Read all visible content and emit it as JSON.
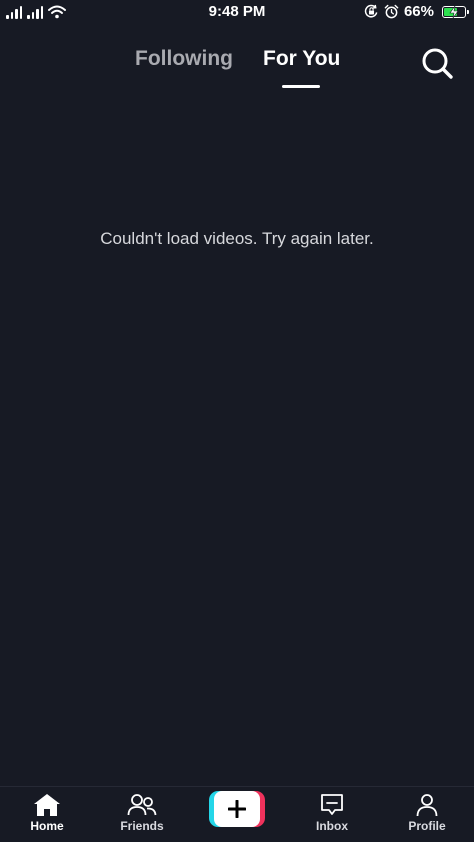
{
  "status_bar": {
    "time": "9:48 PM",
    "battery_percent": "66%",
    "battery_level": 0.66,
    "icons": [
      "signal-icon",
      "signal-icon",
      "wifi-icon",
      "orientation-lock-icon",
      "alarm-icon",
      "battery-icon"
    ]
  },
  "top_nav": {
    "tabs": [
      {
        "label": "Following",
        "active": false
      },
      {
        "label": "For You",
        "active": true
      }
    ],
    "search_icon": "search-icon"
  },
  "feed": {
    "message": "Couldn't load videos. Try again later."
  },
  "bottom_nav": {
    "items": [
      {
        "label": "Home",
        "icon": "home-icon",
        "active": true
      },
      {
        "label": "Friends",
        "icon": "friends-icon",
        "active": false
      },
      {
        "label": "",
        "icon": "plus-icon",
        "active": false
      },
      {
        "label": "Inbox",
        "icon": "inbox-icon",
        "active": false
      },
      {
        "label": "Profile",
        "icon": "profile-icon",
        "active": false
      }
    ]
  },
  "colors": {
    "background": "#171a24",
    "create_cyan": "#24d6e8",
    "create_pink": "#f0325c",
    "battery_green": "#2ee04f"
  }
}
